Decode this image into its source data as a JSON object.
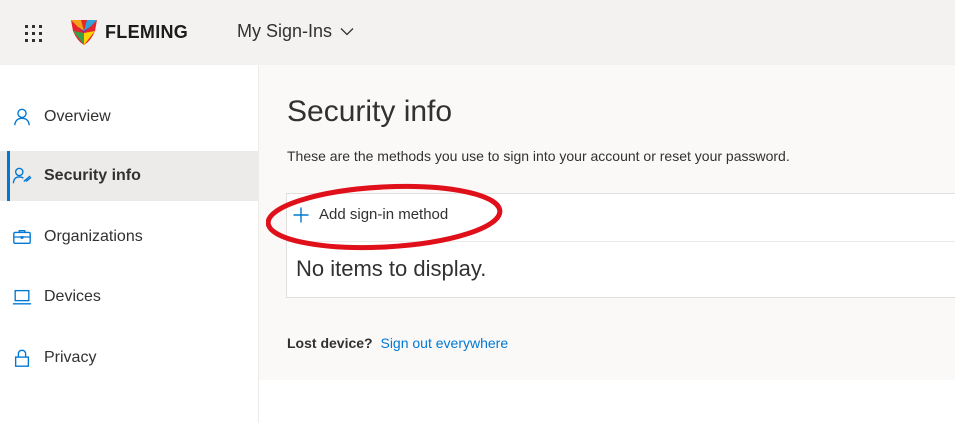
{
  "header": {
    "brand": "FLEMING",
    "app_name": "My Sign-Ins"
  },
  "sidebar": {
    "items": [
      {
        "label": "Overview",
        "icon": "person-icon",
        "active": false
      },
      {
        "label": "Security info",
        "icon": "security-person-icon",
        "active": true
      },
      {
        "label": "Organizations",
        "icon": "briefcase-icon",
        "active": false
      },
      {
        "label": "Devices",
        "icon": "laptop-icon",
        "active": false
      },
      {
        "label": "Privacy",
        "icon": "lock-icon",
        "active": false
      }
    ]
  },
  "main": {
    "title": "Security info",
    "description": "These are the methods you use to sign into your account or reset your password.",
    "add_method_label": "Add sign-in method",
    "empty_text": "No items to display.",
    "lost_device_label": "Lost device?",
    "sign_out_link": "Sign out everywhere"
  },
  "colors": {
    "accent": "#0078d4",
    "highlight_circle": "#e0101b",
    "header_bg": "#f3f2f1"
  }
}
